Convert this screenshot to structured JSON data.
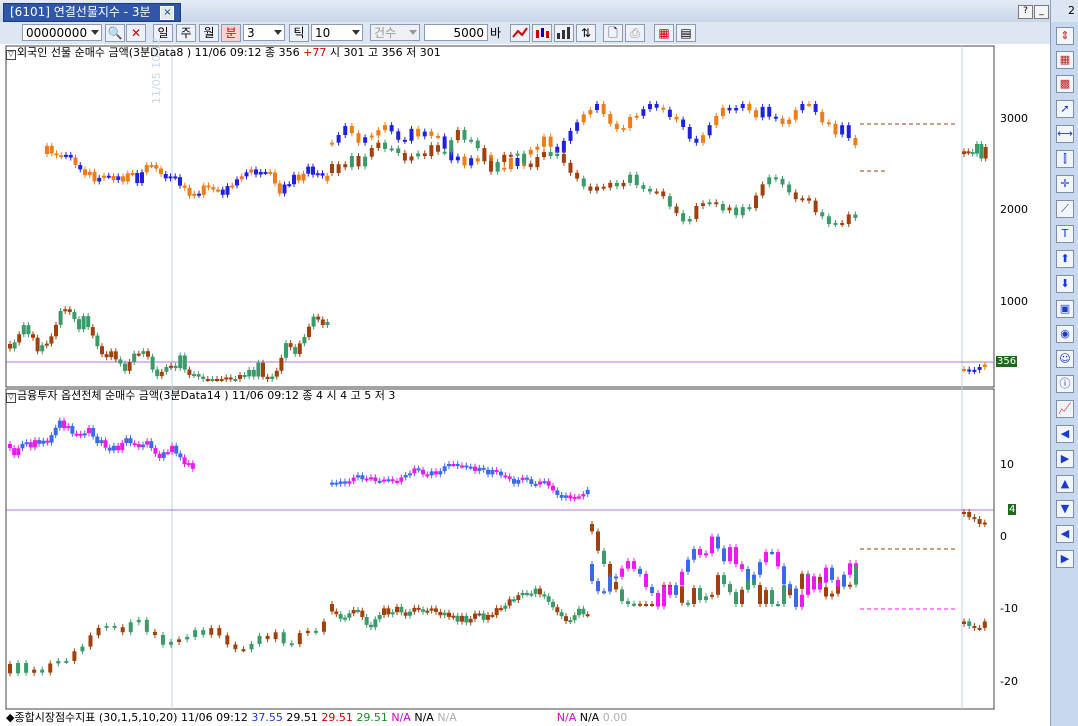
{
  "window": {
    "title": "[6101] 연결선물지수  - 3분",
    "corner_label": "2",
    "help": "?",
    "min": "_",
    "max": "□",
    "close": "×"
  },
  "toolbar": {
    "code": "00000000",
    "period_day": "일",
    "period_week": "주",
    "period_month": "월",
    "period_min": "분",
    "minute_value": "3",
    "tick_label": "틱",
    "tick_value": "10",
    "count_label": "건수",
    "count_value": "5000",
    "bar_label": "바"
  },
  "panels": {
    "top": {
      "header_pre": "외국인 선물 순매수 금액(3분Data8 ) 11/06 09:12   종 356 ",
      "change": "+77",
      "header_post": "   시 301 고 356 저 301",
      "y_ticks": [
        "3000",
        "2000",
        "1000"
      ],
      "last_value": "356",
      "watermark": "11/05 10:12"
    },
    "middle": {
      "header": "금융투자 옵션전체 순매수 금액(3분Data14 ) 11/06 09:12   종 4   시 4 고 5 저 3",
      "y_ticks": [
        "10",
        "0",
        "-10",
        "-20"
      ],
      "last_value": "4"
    },
    "bottom": {
      "header_label": "◆종합시장점수지표 (30,1,5,10,20) 11/06 09:12 ",
      "v1": "37.55",
      "v2": "29.51",
      "v3": "29.51",
      "v4": "29.51",
      "na1": "N/A",
      "na2": "N/A",
      "na3": "N/A",
      "na4": "N/A",
      "na5": "N/A",
      "zero": "0.00"
    }
  },
  "colors": {
    "brown": "#a0400c",
    "orange": "#f07c18",
    "blue": "#2020e0",
    "green": "#3a9a6a",
    "magenta": "#f018f0",
    "royal": "#3a6ae8",
    "hline": "#b070e0"
  },
  "sidebar": {
    "icons": [
      "scroll-icon",
      "grid-icon",
      "chart-icon",
      "pointer-icon",
      "hline-icon",
      "vline-icon",
      "cross-icon",
      "trend-icon",
      "text-icon",
      "up-arrow-icon",
      "down-arrow-icon",
      "rect-icon",
      "circle-icon",
      "smile-icon",
      "info-icon",
      "mini-chart-icon",
      "left-icon",
      "right-icon",
      "up-icon",
      "down-icon",
      "prev-icon",
      "next-icon"
    ]
  }
}
